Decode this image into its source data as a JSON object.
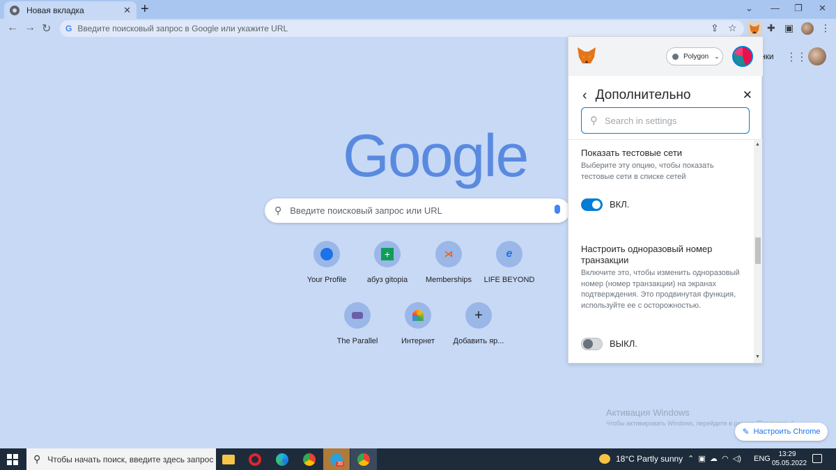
{
  "browser": {
    "tab_title": "Новая вкладка",
    "tab_close": "✕",
    "new_tab": "+",
    "omnibox_placeholder": "Введите поисковый запрос в Google или укажите URL"
  },
  "ntp": {
    "logo_text": "Google",
    "search_placeholder": "Введите поисковый запрос или URL",
    "partial_link": "нки",
    "shortcuts": [
      {
        "label": "Your Profile",
        "icon": "sailboat-icon"
      },
      {
        "label": "абуз gitopia",
        "icon": "green-plus-icon"
      },
      {
        "label": "Memberships",
        "icon": "fnatic-icon"
      },
      {
        "label": "LIFE BEYOND",
        "icon": "life-beyond-icon"
      },
      {
        "label": "The Parallel",
        "icon": "parallel-icon"
      },
      {
        "label": "Интернет",
        "icon": "rainbow-icon"
      },
      {
        "label": "Добавить яр...",
        "icon": "plus-icon"
      }
    ],
    "customize_label": "Настроить Chrome"
  },
  "windows_activation": {
    "title": "Активация Windows",
    "subtitle": "Чтобы активировать Windows, перейдите в раздел \"Параметры\"."
  },
  "metamask": {
    "network": "Polygon",
    "page_title": "Дополнительно",
    "search_placeholder": "Search in settings",
    "settings": [
      {
        "title": "Показать тестовые сети",
        "description": "Выберите эту опцию, чтобы показать тестовые сети в списке сетей",
        "state": "ВКЛ.",
        "enabled": true
      },
      {
        "title": "Настроить одноразовый номер транзакции",
        "description": "Включите это, чтобы изменить одноразовый номер (номер транзакции) на экранах подтверждения. Это продвинутая функция, используйте ее с осторожностью.",
        "state": "ВЫКЛ.",
        "enabled": false
      }
    ]
  },
  "taskbar": {
    "search_placeholder": "Чтобы начать поиск, введите здесь запрос",
    "telegram_badge": "35",
    "weather": "18°C  Partly sunny",
    "language": "ENG",
    "time": "13:29",
    "date": "05.05.2022"
  },
  "colors": {
    "page_bg": "#c7d9f5",
    "metamask_blue": "#037dd6",
    "google_blue": "#5a8ae0",
    "taskbar_bg": "#1d2b3a"
  }
}
